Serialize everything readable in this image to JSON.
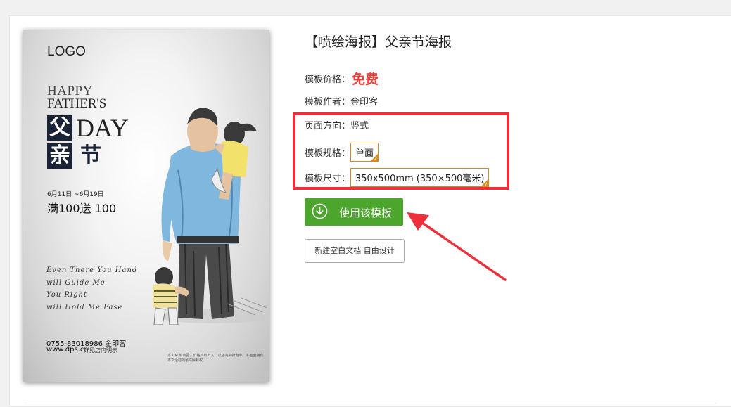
{
  "poster": {
    "logo": "LOGO",
    "happy": "HAPPY",
    "fathers": "FATHER'S",
    "char_fu": "父",
    "char_qin": "亲",
    "char_jie": "节",
    "day": "DAY",
    "date_range": "6月11日 ~6月19日",
    "promo": "满100送 100",
    "script_lines": [
      "Even There You Hand",
      "will Guide Me",
      "You Right",
      "will Hold Me Fase"
    ],
    "phone": "0755-83018986 金印客",
    "website": "www.dps.cn",
    "note": "详见店内明示",
    "fine_print": "本 DM 单商品，价格如有出入，以店内实物为准。本画面拥有本次活动的最终解释权。"
  },
  "template": {
    "title": "【喷绘海报】父亲节海报",
    "price_label": "模板价格：",
    "price_value": "免费",
    "author_label": "模板作者：",
    "author_value": "金印客",
    "orientation_label": "页面方向：",
    "orientation_value": "竖式",
    "spec_label": "模板规格：",
    "spec_value": "单面",
    "size_label": "模板尺寸：",
    "size_value": "350x500mm (350×500毫米)"
  },
  "actions": {
    "use_template": "使用该模板",
    "new_blank": "新建空白文档 自由设计"
  },
  "colors": {
    "price_red": "#e8413b",
    "highlight_red": "#ec2f3b",
    "button_green": "#4ca62d",
    "selected_orange": "#d98e1a"
  }
}
